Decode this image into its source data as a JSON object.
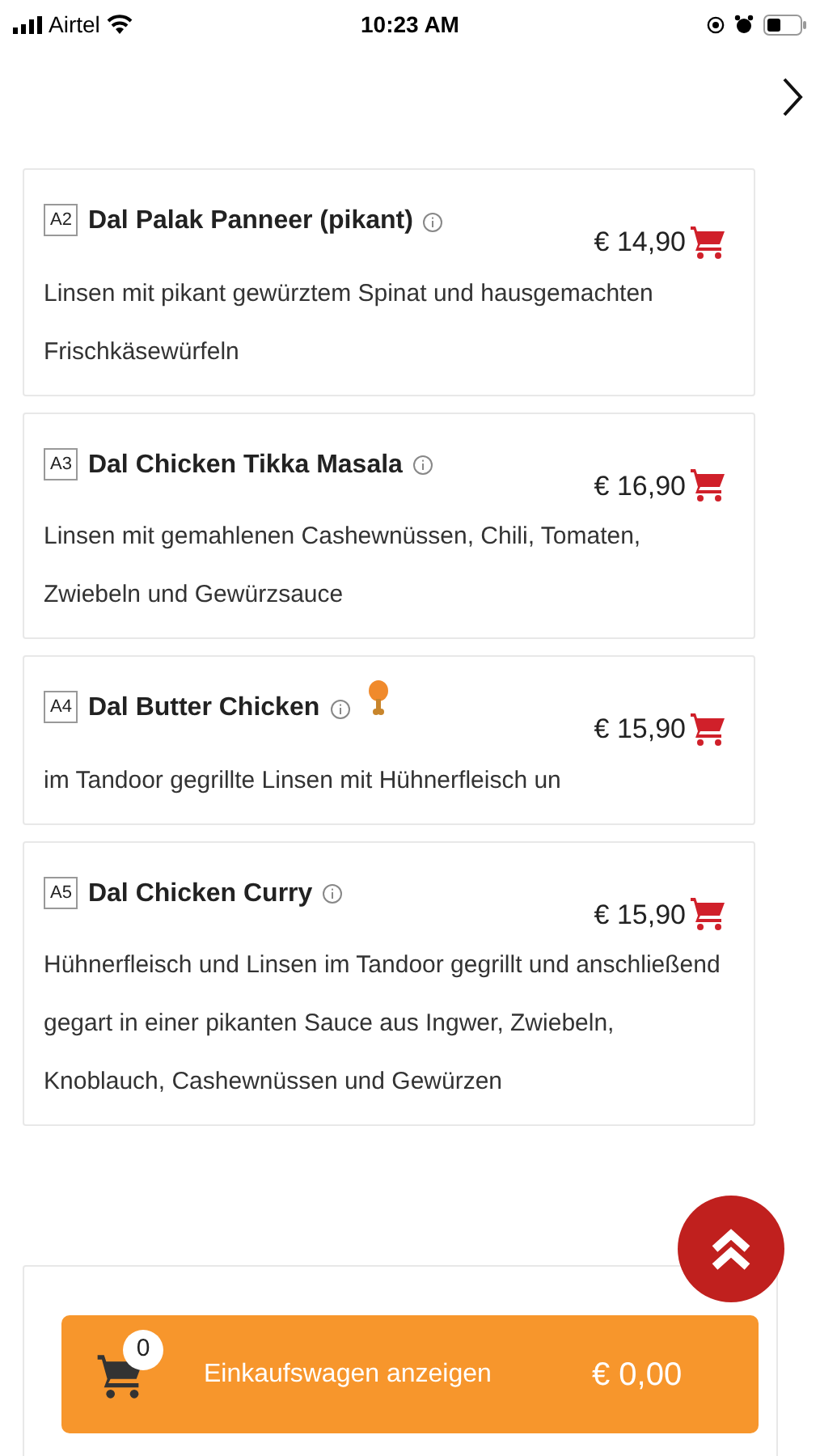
{
  "status_bar": {
    "carrier": "Airtel",
    "time": "10:23 AM"
  },
  "items": [
    {
      "code": "A2",
      "name": "Dal Palak Panneer (pikant)",
      "price": "€ 14,90",
      "description": "Linsen mit pikant gewürztem Spinat und hausgemachten Frischkäsewürfeln",
      "chicken_icon": false
    },
    {
      "code": "A3",
      "name": "Dal Chicken Tikka Masala",
      "price": "€ 16,90",
      "description": "Linsen mit gemahlenen Cashewnüssen, Chili, Tomaten, Zwiebeln und Gewürzsauce",
      "chicken_icon": false
    },
    {
      "code": "A4",
      "name": "Dal Butter Chicken",
      "price": "€ 15,90",
      "description": "im Tandoor gegrillte Linsen mit Hühnerfleisch un",
      "chicken_icon": true
    },
    {
      "code": "A5",
      "name": "Dal Chicken Curry",
      "price": "€ 15,90",
      "description": "Hühnerfleisch und Linsen im Tandoor gegrillt und anschließend gegart in einer pikanten Sauce aus Ingwer, Zwiebeln, Knoblauch, Cashewnüssen und Gewürzen",
      "chicken_icon": false
    }
  ],
  "cart_bar": {
    "count": "0",
    "label": "Einkaufswagen anzeigen",
    "total": "€ 0,00"
  }
}
